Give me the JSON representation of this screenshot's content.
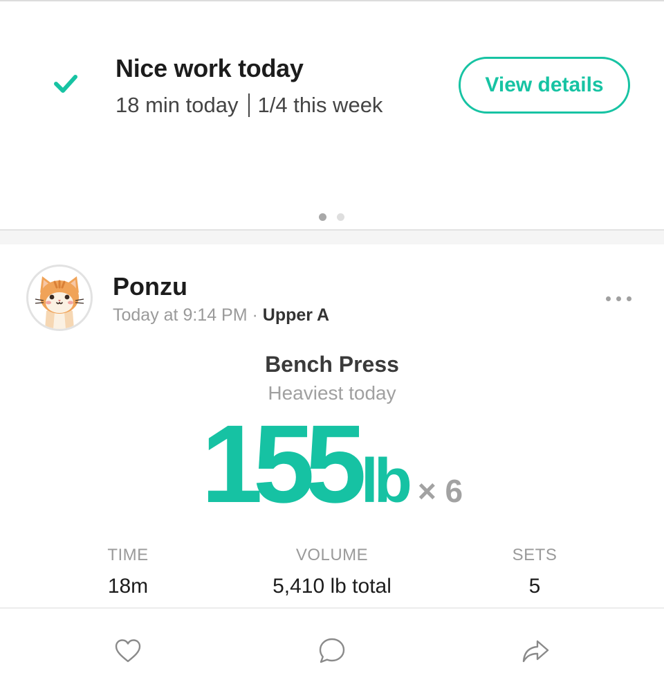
{
  "summary": {
    "title": "Nice work today",
    "minutes_today": "18 min today",
    "week_progress": "1/4 this week",
    "view_details_label": "View details",
    "carousel_pages": 2,
    "carousel_active": 1
  },
  "post": {
    "user_name": "Ponzu",
    "timestamp": "Today at 9:14 PM",
    "meta_separator": "·",
    "routine": "Upper A",
    "avatar_icon": "cat-avatar",
    "more_icon": "more-horizontal-icon",
    "exercise_name": "Bench Press",
    "exercise_sub": "Heaviest today",
    "weight": "155",
    "weight_unit": "lb",
    "reps": "× 6",
    "stats": {
      "time_label": "TIME",
      "time_value": "18m",
      "volume_label": "VOLUME",
      "volume_value": "5,410 lb total",
      "sets_label": "SETS",
      "sets_value": "5"
    }
  },
  "actions": {
    "like_icon": "heart-icon",
    "comment_icon": "comment-icon",
    "share_icon": "share-icon"
  },
  "colors": {
    "accent": "#17c3a3",
    "muted": "#9a9a9a",
    "text": "#1c1c1c"
  }
}
